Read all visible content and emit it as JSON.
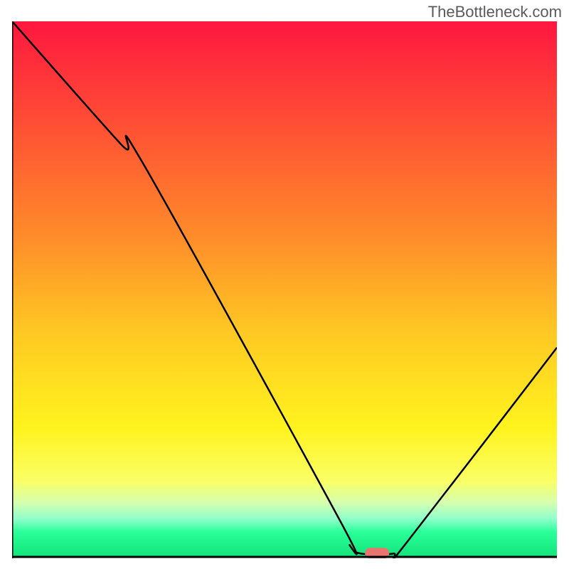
{
  "watermark": "TheBottleneck.com",
  "chart_data": {
    "type": "line",
    "title": "",
    "xlabel": "",
    "ylabel": "",
    "xlim": [
      0,
      100
    ],
    "ylim": [
      0,
      100
    ],
    "gradient": {
      "stops": [
        {
          "offset": 0,
          "color": "#ff173f"
        },
        {
          "offset": 40,
          "color": "#ff8b2a"
        },
        {
          "offset": 58,
          "color": "#ffc823"
        },
        {
          "offset": 76,
          "color": "#fff31e"
        },
        {
          "offset": 86,
          "color": "#faff65"
        },
        {
          "offset": 90,
          "color": "#d5ffb0"
        },
        {
          "offset": 93,
          "color": "#90ffca"
        },
        {
          "offset": 95.5,
          "color": "#2aff99"
        },
        {
          "offset": 100,
          "color": "#14e57b"
        }
      ]
    },
    "curve": {
      "description": "V-shaped bottleneck curve",
      "points": [
        {
          "x": 0,
          "y": 100
        },
        {
          "x": 20,
          "y": 77
        },
        {
          "x": 24,
          "y": 73.5
        },
        {
          "x": 60,
          "y": 7
        },
        {
          "x": 62,
          "y": 2
        },
        {
          "x": 64,
          "y": 0.5
        },
        {
          "x": 70,
          "y": 0.5
        },
        {
          "x": 72,
          "y": 2
        },
        {
          "x": 100,
          "y": 39
        }
      ]
    },
    "marker": {
      "x": 67,
      "y": 0.5,
      "color": "#e8766f"
    }
  }
}
